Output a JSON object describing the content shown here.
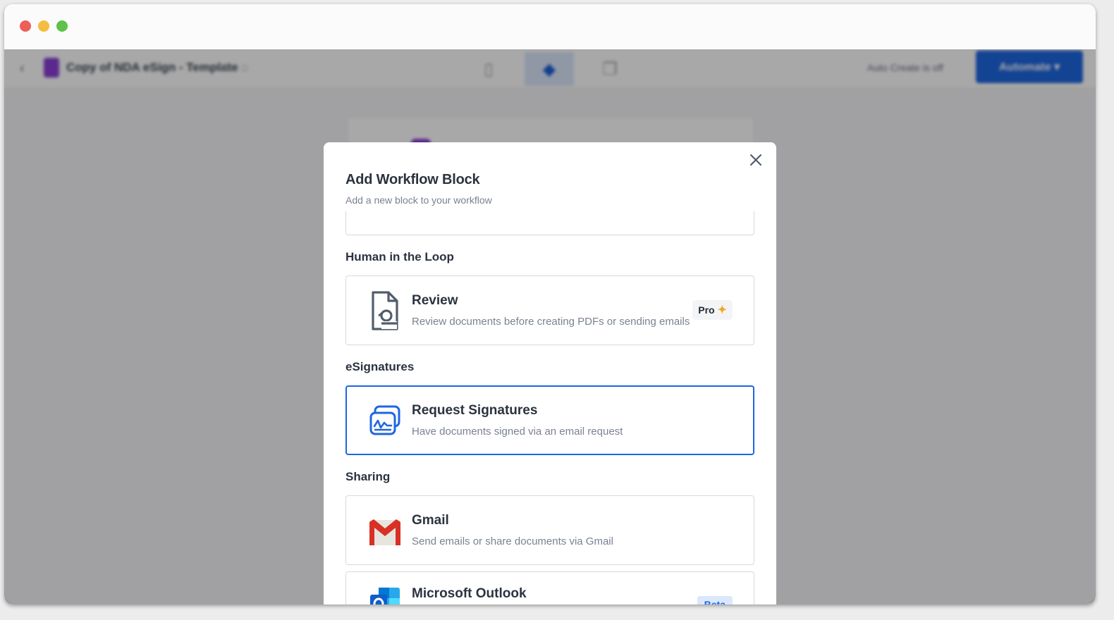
{
  "app": {
    "doc_title": "Copy of NDA eSign - Template",
    "doc_path_separator": "/",
    "autosave_label": "Auto Create is off",
    "automate_label": "Automate ▾"
  },
  "modal": {
    "title": "Add Workflow Block",
    "subtitle": "Add a new block to your workflow",
    "sections": [
      {
        "label": "Human in the Loop",
        "blocks": [
          {
            "title": "Review",
            "description": "Review documents before creating PDFs or sending emails",
            "icon": "review-document-icon",
            "badge": "Pro"
          }
        ]
      },
      {
        "label": "eSignatures",
        "blocks": [
          {
            "title": "Request Signatures",
            "description": "Have documents signed via an email request",
            "icon": "signature-icon",
            "selected": true
          }
        ]
      },
      {
        "label": "Sharing",
        "blocks": [
          {
            "title": "Gmail",
            "description": "Send emails or share documents via Gmail",
            "icon": "gmail-icon"
          },
          {
            "title": "Microsoft Outlook",
            "description": "",
            "icon": "outlook-icon",
            "badge": "Beta"
          }
        ]
      }
    ]
  },
  "colors": {
    "accent": "#1e66e0",
    "pro_spark": "#f5a623",
    "gmail_red": "#d93025"
  }
}
